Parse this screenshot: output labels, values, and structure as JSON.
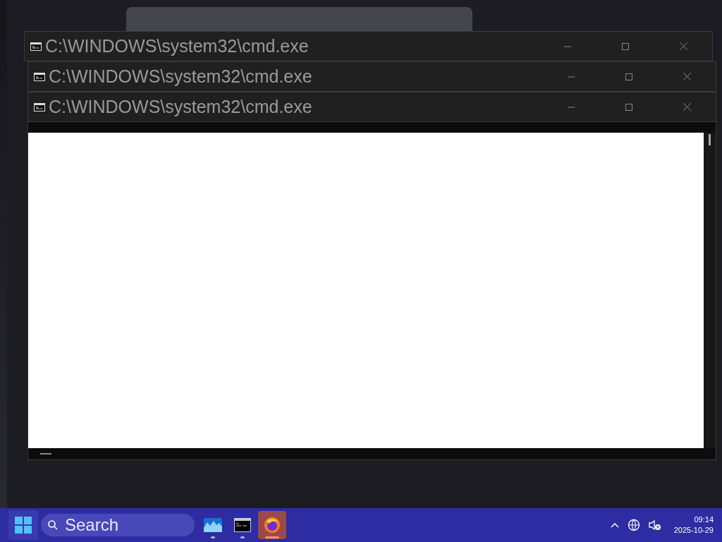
{
  "windows": [
    {
      "title": "C:\\WINDOWS\\system32\\cmd.exe"
    },
    {
      "title": "C:\\WINDOWS\\system32\\cmd.exe"
    },
    {
      "title": "C:\\WINDOWS\\system32\\cmd.exe"
    }
  ],
  "taskbar": {
    "search": {
      "placeholder": "Search"
    },
    "apps": [
      {
        "kind": "monitor",
        "selected": false
      },
      {
        "kind": "terminal",
        "selected": false
      },
      {
        "kind": "browser",
        "selected": true
      }
    ],
    "time": "09:14",
    "date": "2025-10-29"
  }
}
